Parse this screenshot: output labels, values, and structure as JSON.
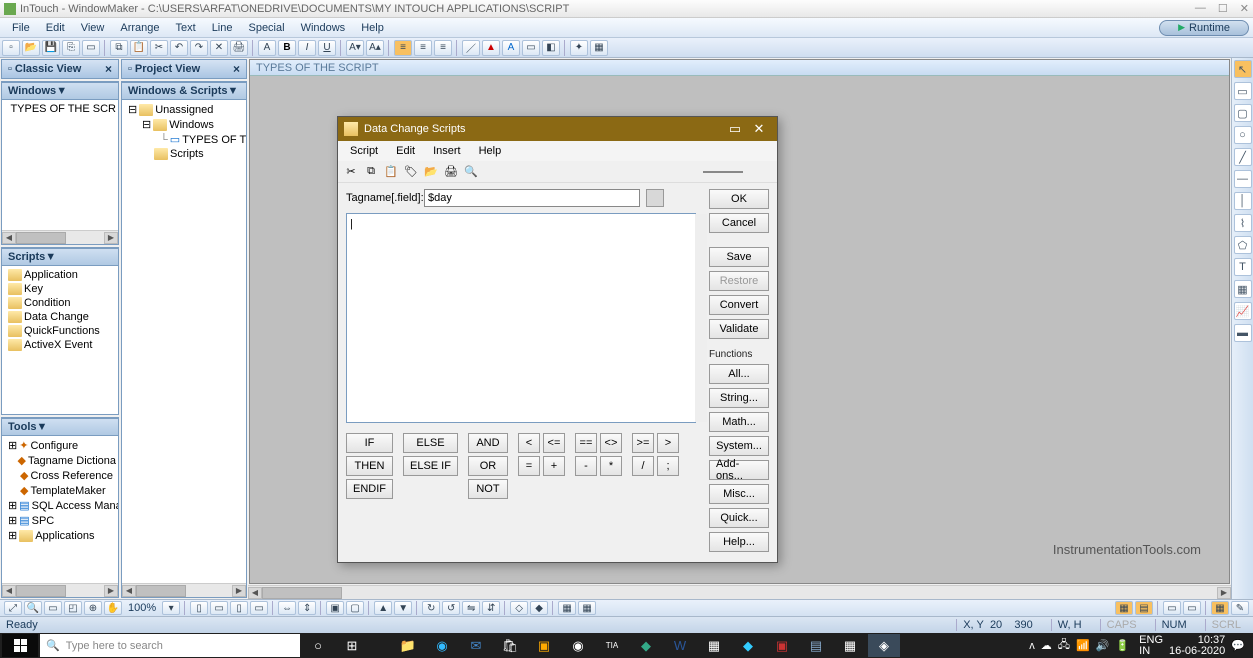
{
  "titlebar": {
    "title": "InTouch - WindowMaker - C:\\USERS\\ARFAT\\ONEDRIVE\\DOCUMENTS\\MY INTOUCH APPLICATIONS\\SCRIPT"
  },
  "menubar": {
    "items": [
      "File",
      "Edit",
      "View",
      "Arrange",
      "Text",
      "Line",
      "Special",
      "Windows",
      "Help"
    ],
    "runtime_label": "Runtime"
  },
  "classic_panel": {
    "title": "Classic View"
  },
  "project_panel": {
    "title": "Project View"
  },
  "windows_panel": {
    "title": "Windows",
    "items": [
      "TYPES OF THE SCR"
    ]
  },
  "windows_scripts_panel": {
    "title": "Windows & Scripts",
    "tree": {
      "root": "Unassigned",
      "windows_node": "Windows",
      "window_item": "TYPES OF T",
      "scripts_node": "Scripts"
    }
  },
  "scripts_panel": {
    "title": "Scripts",
    "items": [
      "Application",
      "Key",
      "Condition",
      "Data Change",
      "QuickFunctions",
      "ActiveX Event"
    ]
  },
  "tools_panel": {
    "title": "Tools",
    "items": [
      "Configure",
      "Tagname Dictiona",
      "Cross Reference",
      "TemplateMaker",
      "SQL Access Mana",
      "SPC",
      "Applications"
    ]
  },
  "canvas": {
    "window_title": "TYPES OF THE SCRIPT"
  },
  "watermark": "InstrumentationTools.com",
  "dialog": {
    "title": "Data Change Scripts",
    "menu": [
      "Script",
      "Edit",
      "Insert",
      "Help"
    ],
    "tagname_label": "Tagname[.field]:",
    "tagname_value": "$day",
    "script_content": "|",
    "buttons": {
      "ok": "OK",
      "cancel": "Cancel",
      "save": "Save",
      "restore": "Restore",
      "convert": "Convert",
      "validate": "Validate",
      "functions_label": "Functions",
      "all": "All...",
      "string": "String...",
      "math": "Math...",
      "system": "System...",
      "addons": "Add-ons...",
      "misc": "Misc...",
      "quick": "Quick...",
      "help": "Help..."
    },
    "kw": {
      "if": "IF",
      "then": "THEN",
      "endif": "ENDIF",
      "else": "ELSE",
      "elseif": "ELSE IF",
      "and": "AND",
      "or": "OR",
      "not": "NOT"
    },
    "ops": {
      "lt": "<",
      "le": "<=",
      "eq": "==",
      "ne": "<>",
      "ge": ">=",
      "gt": ">",
      "assign": "=",
      "plus": "+",
      "minus": "-",
      "mul": "*",
      "div": "/",
      "semi": ";"
    }
  },
  "zoom": "100%",
  "statusbar": {
    "left": "Ready",
    "xy_label": "X, Y",
    "xy_x": "20",
    "xy_y": "390",
    "wh_label": "W, H",
    "caps": "CAPS",
    "num": "NUM",
    "scrl": "SCRL"
  },
  "taskbar": {
    "search_placeholder": "Type here to search",
    "lang1": "ENG",
    "lang2": "IN",
    "time": "10:37",
    "date": "16-06-2020"
  }
}
